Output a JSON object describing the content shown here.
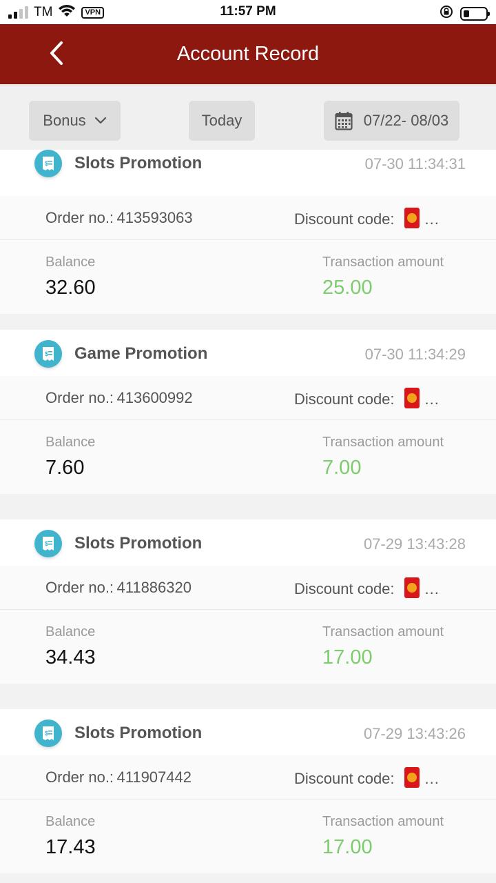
{
  "status_bar": {
    "carrier": "TM",
    "vpn": "VPN",
    "time": "11:57 PM",
    "battery_level": 0.25
  },
  "header": {
    "title": "Account Record"
  },
  "filters": {
    "type_label": "Bonus",
    "today_label": "Today",
    "date_range": "07/22- 08/03"
  },
  "labels": {
    "order": "Order no.:",
    "discount": "Discount code:",
    "ellipsis": "...",
    "balance": "Balance",
    "transaction": "Transaction amount"
  },
  "records": [
    {
      "title": "Slots Promotion",
      "time": "07-30 11:34:31",
      "order_no": "413593063",
      "balance": "32.60",
      "amount": "25.00"
    },
    {
      "title": "Game Promotion",
      "time": "07-30 11:34:29",
      "order_no": "413600992",
      "balance": "7.60",
      "amount": "7.00"
    },
    {
      "title": "Slots Promotion",
      "time": "07-29 13:43:28",
      "order_no": "411886320",
      "balance": "34.43",
      "amount": "17.00"
    },
    {
      "title": "Slots Promotion",
      "time": "07-29 13:43:26",
      "order_no": "411907442",
      "balance": "17.43",
      "amount": "17.00"
    }
  ],
  "colors": {
    "header_bg": "#8d1810",
    "amount_green": "#7ccc6e",
    "icon_teal": "#3fb4cc"
  }
}
